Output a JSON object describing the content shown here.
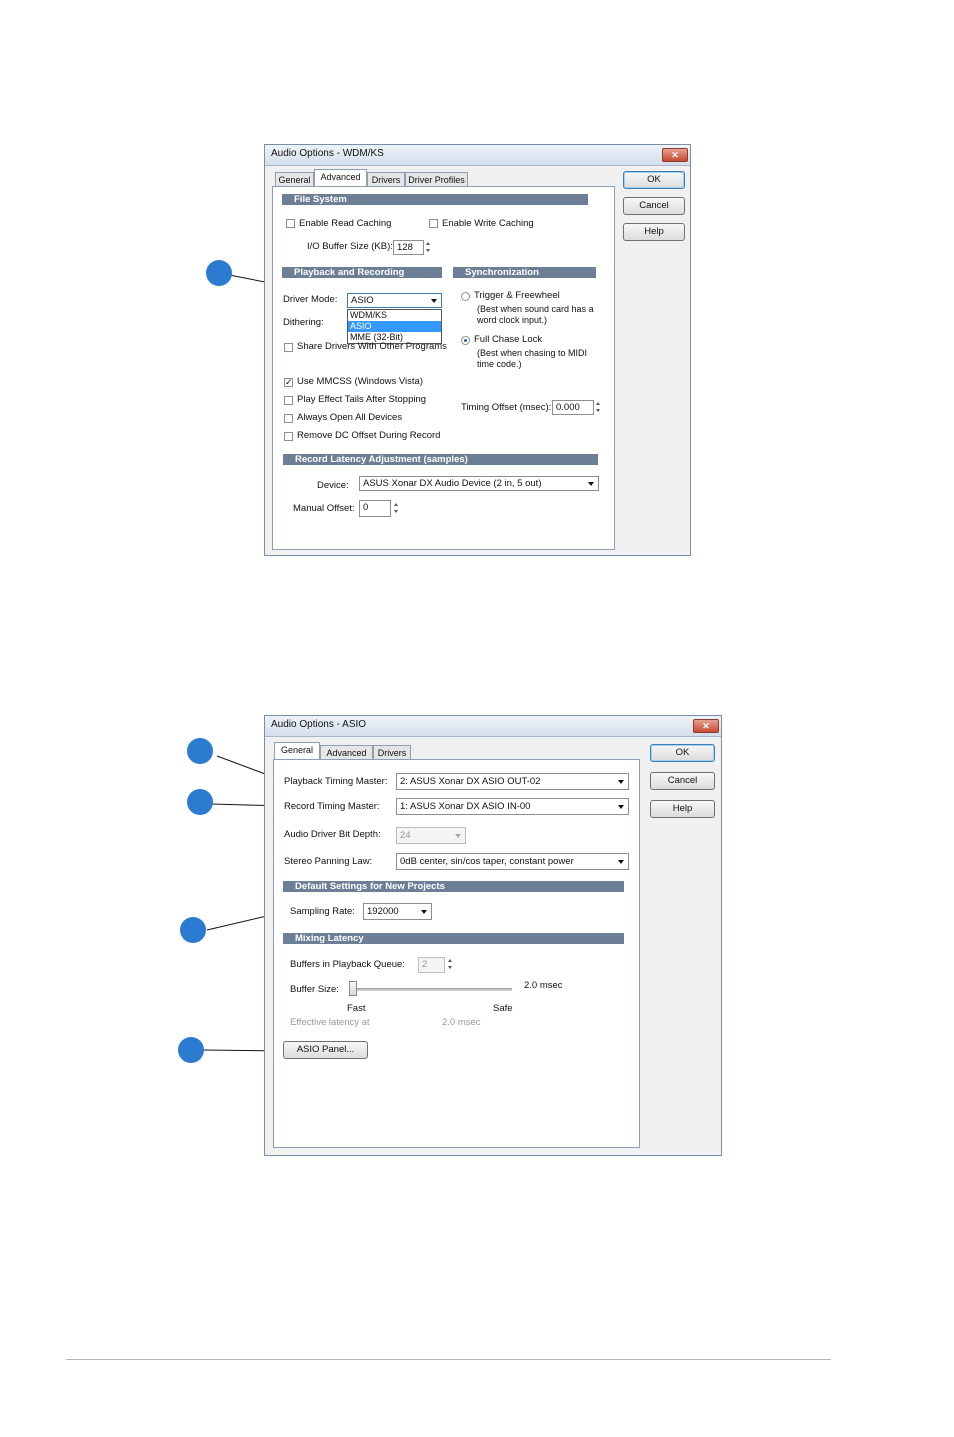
{
  "dialog1": {
    "title": "Audio Options - WDM/KS",
    "close": "✕",
    "tabs": [
      "General",
      "Advanced",
      "Drivers",
      "Driver Profiles"
    ],
    "buttons": {
      "ok": "OK",
      "cancel": "Cancel",
      "help": "Help"
    },
    "file_system": {
      "header": "File System",
      "enable_read_caching": "Enable Read Caching",
      "enable_write_caching": "Enable Write Caching",
      "io_buffer_label": "I/O Buffer Size (KB):",
      "io_buffer_value": "128"
    },
    "playback": {
      "header": "Playback and Recording",
      "driver_mode_label": "Driver Mode:",
      "driver_mode_value": "ASIO",
      "driver_mode_options": [
        "WDM/KS",
        "ASIO",
        "MME (32-Bit)"
      ],
      "dithering_label": "Dithering:",
      "share_drivers": "Share Drivers With Other Programs",
      "use_mmcss": "Use MMCSS (Windows Vista)",
      "use_mmcss_checked": "✓",
      "play_effect_tails": "Play Effect Tails After Stopping",
      "always_open": "Always Open All Devices",
      "remove_dc": "Remove DC Offset During Record"
    },
    "sync": {
      "header": "Synchronization",
      "trigger_line1": "Trigger & Freewheel",
      "trigger_line2": "(Best when sound card has a",
      "trigger_line3": "word clock input.)",
      "chase_line1": "Full Chase Lock",
      "chase_line2": "(Best when chasing to MIDI",
      "chase_line3": "time code.)",
      "timing_offset_label": "Timing Offset (msec):",
      "timing_offset_value": "0.000"
    },
    "latency": {
      "header": "Record Latency Adjustment (samples)",
      "device_label": "Device:",
      "device_value": "ASUS Xonar DX Audio Device (2 in, 5 out)",
      "manual_offset_label": "Manual Offset:",
      "manual_offset_value": "0"
    }
  },
  "dialog2": {
    "title": "Audio Options - ASIO",
    "close": "✕",
    "tabs": [
      "General",
      "Advanced",
      "Drivers"
    ],
    "buttons": {
      "ok": "OK",
      "cancel": "Cancel",
      "help": "Help"
    },
    "playback_master_label": "Playback Timing Master:",
    "playback_master_value": "2: ASUS Xonar DX ASIO OUT-02",
    "record_master_label": "Record Timing Master:",
    "record_master_value": "1: ASUS Xonar DX ASIO IN-00",
    "bit_depth_label": "Audio Driver Bit Depth:",
    "bit_depth_value": "24",
    "panning_label": "Stereo Panning Law:",
    "panning_value": "0dB center, sin/cos taper, constant power",
    "defaults_header": "Default Settings for New Projects",
    "sampling_rate_label": "Sampling Rate:",
    "sampling_rate_value": "192000",
    "mixing_header": "Mixing Latency",
    "buffers_label": "Buffers in Playback Queue:",
    "buffers_value": "2",
    "buffer_size_label": "Buffer Size:",
    "buffer_size_value": "2.0 msec",
    "fast": "Fast",
    "safe": "Safe",
    "effective_label": "Effective latency at",
    "effective_value": "2.0 msec",
    "asio_panel": "ASIO Panel..."
  },
  "colors": {
    "callout": "#2b7bd1",
    "section_header": "#6d7f96",
    "selection": "#3399ff"
  }
}
